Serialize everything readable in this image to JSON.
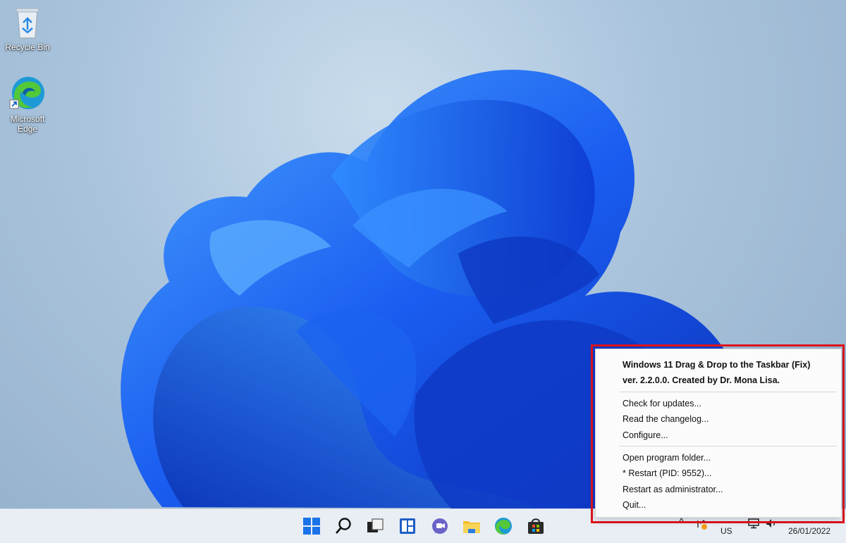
{
  "desktop": {
    "icons": [
      {
        "label": "Recycle Bin"
      },
      {
        "label_line1": "Microsoft",
        "label_line2": "Edge"
      }
    ]
  },
  "taskbar": {
    "apps": [
      "start-icon",
      "search-icon",
      "task-view-icon",
      "widgets-icon",
      "teams-chat-icon",
      "file-explorer-icon",
      "edge-icon",
      "store-icon"
    ],
    "tray": {
      "chevron": "^",
      "language": "US",
      "date": "26/01/2022"
    }
  },
  "context_menu": {
    "header_title": "Windows 11 Drag & Drop to the Taskbar (Fix)",
    "header_version": "ver. 2.2.0.0. Created by Dr. Mona Lisa.",
    "items": [
      {
        "label": "Check for updates..."
      },
      {
        "label": "Read the changelog..."
      },
      {
        "label": "Configure..."
      },
      {
        "label": "Open program folder..."
      },
      {
        "label": "* Restart (PID: 9552)..."
      },
      {
        "label": "Restart as administrator..."
      },
      {
        "label": "Quit..."
      }
    ],
    "highlight_color": "#e0141b"
  }
}
